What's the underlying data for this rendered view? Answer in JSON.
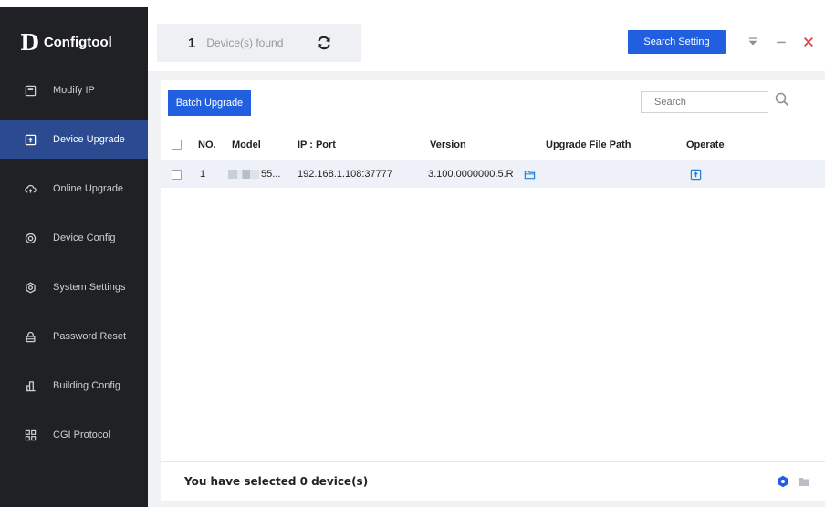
{
  "app": {
    "logo_mark": "D",
    "title": "Configtool"
  },
  "sidebar": {
    "items": [
      {
        "label": "Modify IP",
        "icon": "ip-icon",
        "active": false
      },
      {
        "label": "Device Upgrade",
        "icon": "upgrade-icon",
        "active": true
      },
      {
        "label": "Online Upgrade",
        "icon": "cloud-upgrade-icon",
        "active": false
      },
      {
        "label": "Device Config",
        "icon": "config-icon",
        "active": false
      },
      {
        "label": "System Settings",
        "icon": "settings-icon",
        "active": false
      },
      {
        "label": "Password Reset",
        "icon": "lock-icon",
        "active": false
      },
      {
        "label": "Building Config",
        "icon": "building-icon",
        "active": false
      },
      {
        "label": "CGI Protocol",
        "icon": "grid-icon",
        "active": false
      }
    ]
  },
  "header": {
    "device_count": "1",
    "device_found_text": "Device(s) found",
    "search_setting_label": "Search Setting"
  },
  "toolbar": {
    "batch_upgrade_label": "Batch Upgrade",
    "search_placeholder": "Search"
  },
  "table": {
    "columns": [
      "NO.",
      "Model",
      "IP : Port",
      "Version",
      "Upgrade File Path",
      "Operate"
    ],
    "rows": [
      {
        "no": "1",
        "model": "55...",
        "ip_port": "192.168.1.108:37777",
        "version": "3.100.0000000.5.R",
        "upgrade_file_path": ""
      }
    ]
  },
  "footer": {
    "selected_text": "You have selected 0 device(s)"
  },
  "colors": {
    "sidebar_bg": "#202124",
    "active_item": "#2b4a8f",
    "accent": "#1f5fe0",
    "close_red": "#e03b3b"
  }
}
